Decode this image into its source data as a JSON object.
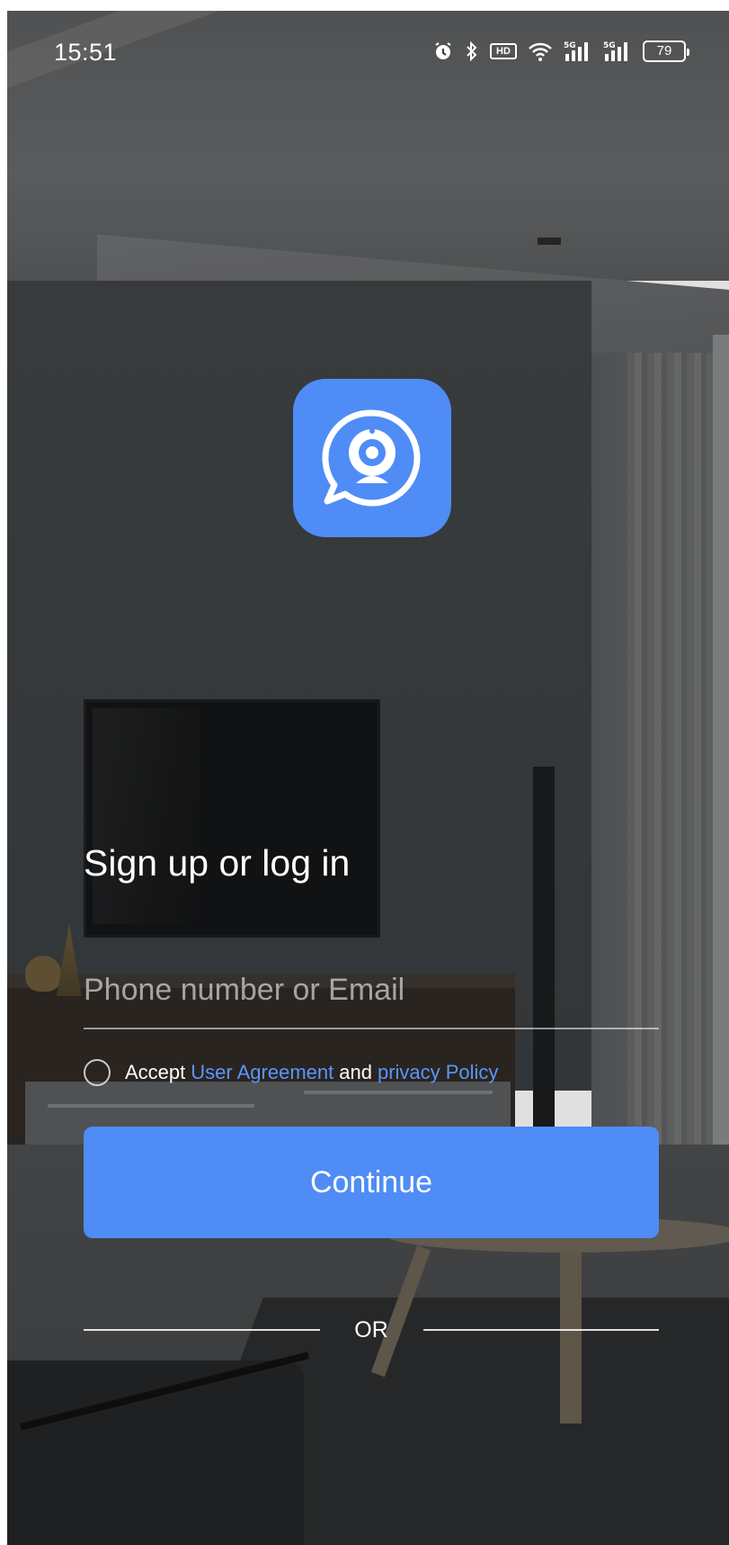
{
  "status_bar": {
    "time": "15:51",
    "icons": [
      "alarm-icon",
      "bluetooth-icon",
      "hd-icon",
      "wifi-icon",
      "signal-5g-icon",
      "signal-5g-icon"
    ],
    "hd_label": "HD",
    "signal_label": "5G",
    "battery_level": "79"
  },
  "logo": {
    "icon": "webcam-chat-icon",
    "color": "#4f8cf6"
  },
  "login": {
    "heading": "Sign up or log in",
    "input_placeholder": "Phone number or Email",
    "input_value": "",
    "agreement": {
      "prefix": "Accept",
      "user_agreement": "User Agreement",
      "conjunction": "and",
      "privacy_policy": "privacy Policy"
    },
    "continue_label": "Continue",
    "or_label": "OR"
  },
  "colors": {
    "accent": "#4f8cf6",
    "link": "#5a95ff",
    "text": "#ffffff"
  }
}
